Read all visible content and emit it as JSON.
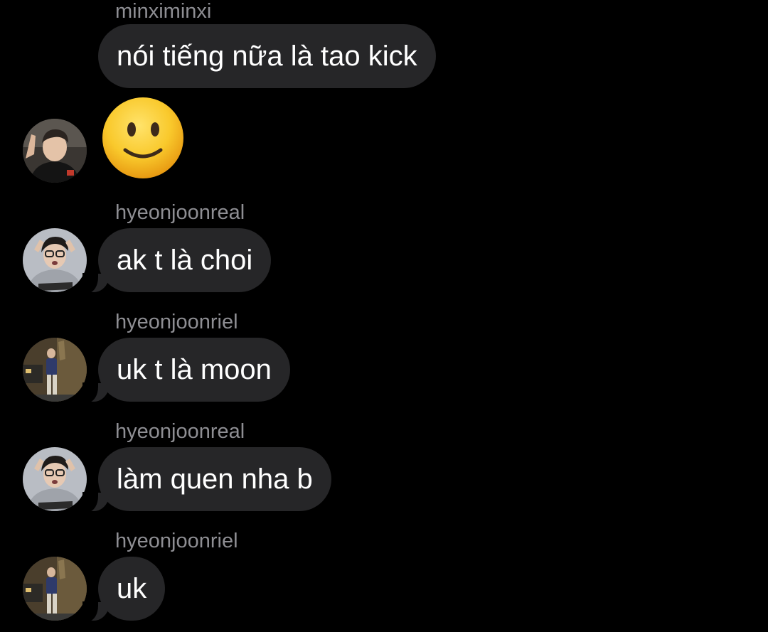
{
  "messages": [
    {
      "sender": "minximinxi",
      "text": "nói tiếng nữa là tao kick"
    },
    {
      "sender": "",
      "emoji": "slightly-smiling-face"
    },
    {
      "sender": "hyeonjoonreal",
      "text": "ak t là choi"
    },
    {
      "sender": "hyeonjoonriel",
      "text": "uk t là moon"
    },
    {
      "sender": "hyeonjoonreal",
      "text": "làm quen nha b"
    },
    {
      "sender": "hyeonjoonriel",
      "text": "uk"
    }
  ],
  "colors": {
    "background": "#000000",
    "bubble": "#262628",
    "sender_text": "#8e8e93",
    "message_text": "#ffffff",
    "emoji_face": "#f7c52b"
  }
}
